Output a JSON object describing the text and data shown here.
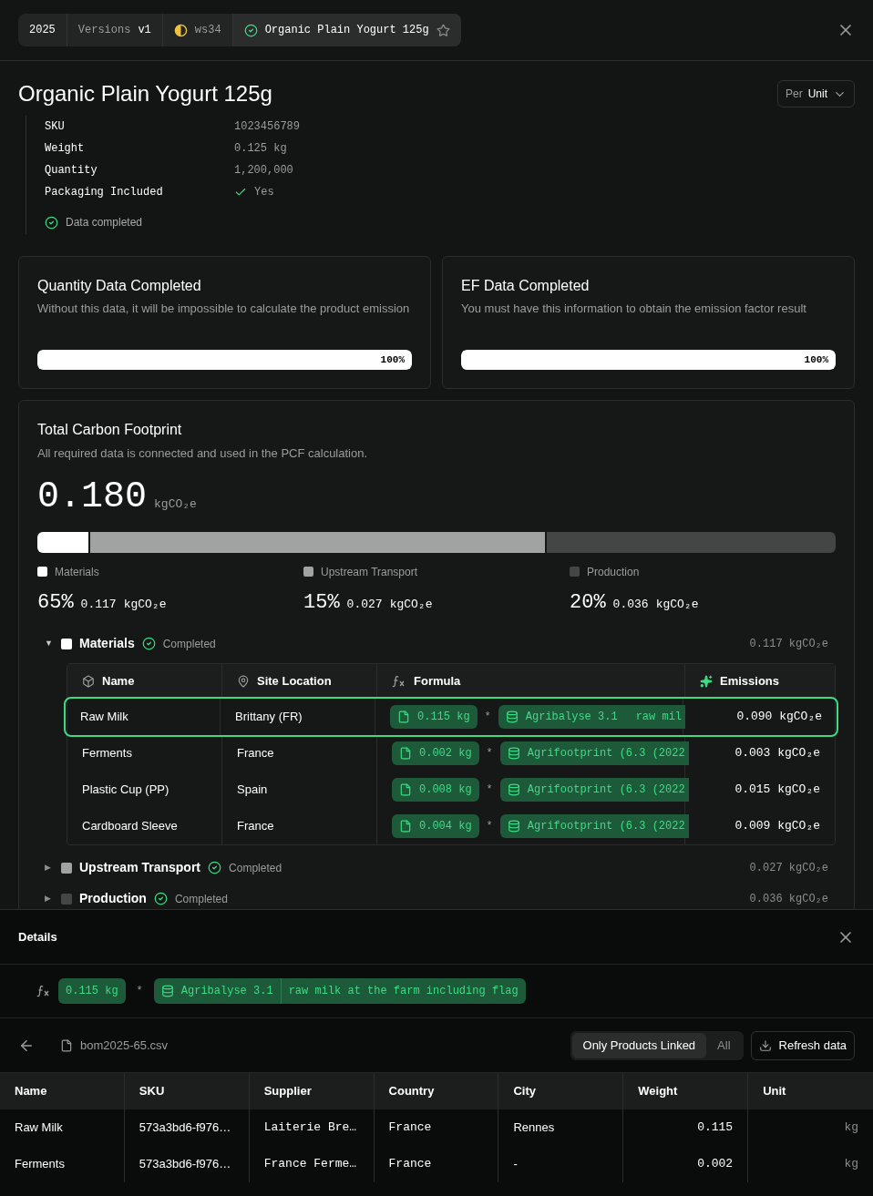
{
  "breadcrumb": {
    "year": "2025",
    "versions_label": "Versions",
    "version": "v1",
    "workspace": "ws34",
    "product": "Organic Plain Yogurt 125g",
    "starred": false
  },
  "title": "Organic Plain Yogurt 125g",
  "per_select": {
    "prefix": "Per",
    "value": "Unit"
  },
  "properties": [
    {
      "label": "SKU",
      "value": "1023456789",
      "kind": "text"
    },
    {
      "label": "Weight",
      "value": "0.125 kg",
      "kind": "text"
    },
    {
      "label": "Quantity",
      "value": "1,200,000",
      "kind": "text"
    },
    {
      "label": "Packaging Included",
      "value": "Yes",
      "kind": "check"
    }
  ],
  "data_status": "Data completed",
  "completion_cards": [
    {
      "title": "Quantity Data Completed",
      "description": "Without this data, it will be impossible to calculate the product emission",
      "level": 1,
      "reading": "100%"
    },
    {
      "title": "EF Data Completed",
      "description": "You must have this information to obtain the emission factor result",
      "level": 1,
      "reading": "100%"
    }
  ],
  "footprint": {
    "title": "Total Carbon Footprint",
    "description": "All required data is connected and used in the PCF calculation.",
    "total": "0.180",
    "unit": "kgCO₂e",
    "breakdown": [
      {
        "name": "Materials",
        "color": "#ffffff",
        "percent": "65%",
        "value": "0.117",
        "unit": "kgCO₂e"
      },
      {
        "name": "Upstream Transport",
        "color": "#a1a3a2",
        "percent": "15%",
        "value": "0.027",
        "unit": "kgCO₂e"
      },
      {
        "name": "Production",
        "color": "#434645",
        "percent": "20%",
        "value": "0.036",
        "unit": "kgCO₂e"
      }
    ],
    "sections": [
      {
        "name": "Materials",
        "color": "#ffffff",
        "expanded": true,
        "toggle": "▼",
        "status": "Completed",
        "total": "0.117 kgCO₂e",
        "columns": [
          "Name",
          "Site Location",
          "Formula",
          "Emissions"
        ],
        "rows": [
          {
            "name": "Raw Milk",
            "location": "Brittany (FR)",
            "quantity": "0.115 kg",
            "operator": "*",
            "source": "Agribalyse 3.1",
            "source_detail": "raw mil",
            "emissions": "0.090 kgCO₂e",
            "selected": true
          },
          {
            "name": "Ferments",
            "location": "France",
            "quantity": "0.002 kg",
            "operator": "*",
            "source": "Agrifootprint (6.3 (2022",
            "emissions": "0.003 kgCO₂e",
            "selected": false
          },
          {
            "name": "Plastic Cup (PP)",
            "location": "Spain",
            "quantity": "0.008 kg",
            "operator": "*",
            "source": "Agrifootprint (6.3 (2022",
            "emissions": "0.015 kgCO₂e",
            "selected": false
          },
          {
            "name": "Cardboard Sleeve",
            "location": "France",
            "quantity": "0.004 kg",
            "operator": "*",
            "source": "Agrifootprint (6.3 (2022",
            "emissions": "0.009 kgCO₂e",
            "selected": false
          }
        ]
      },
      {
        "name": "Upstream Transport",
        "color": "#a1a3a2",
        "expanded": false,
        "toggle": "▶",
        "status": "Completed",
        "total": "0.027 kgCO₂e"
      },
      {
        "name": "Production",
        "color": "#434645",
        "expanded": false,
        "toggle": "▶",
        "status": "Completed",
        "total": "0.036 kgCO₂e"
      }
    ]
  },
  "details": {
    "title": "Details",
    "formula": {
      "quantity": "0.115 kg",
      "operator": "*",
      "source": "Agribalyse 3.1",
      "source_detail": "raw milk at the farm including flag"
    },
    "file": "bom2025-65.csv",
    "filters": [
      {
        "label": "Only Products Linked",
        "selected": true
      },
      {
        "label": "All",
        "selected": false
      }
    ],
    "refresh": "Refresh data",
    "columns": [
      "Name",
      "SKU",
      "Supplier",
      "Country",
      "City",
      "Weight",
      "Unit"
    ],
    "rows": [
      [
        "Raw Milk",
        "573a3bd6-f976…",
        "Laiterie Bre…",
        "France",
        "Rennes",
        "0.115",
        "kg"
      ],
      [
        "Ferments",
        "573a3bd6-f976…",
        "France Ferme…",
        "France",
        "-",
        "0.002",
        "kg"
      ]
    ]
  }
}
